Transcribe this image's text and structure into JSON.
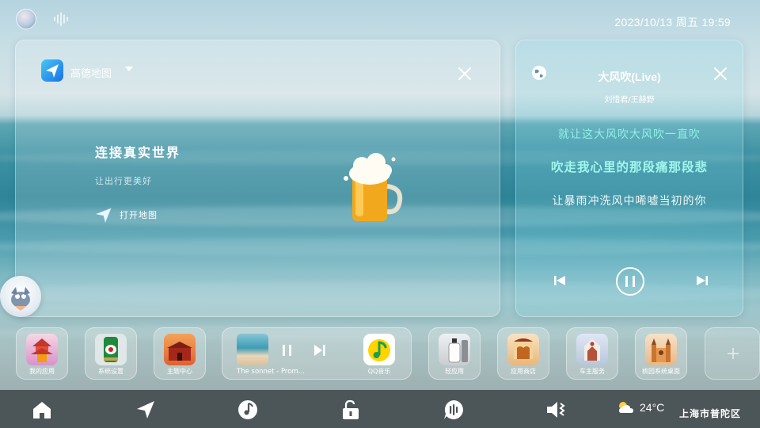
{
  "status_bar": {
    "datetime": "2023/10/13 周五 19:59"
  },
  "map_card": {
    "app_name": "高德地图",
    "slogan": "连接真实世界",
    "subtitle": "让出行更美好",
    "open_label": "打开地图"
  },
  "music_card": {
    "song_title": "大风吹(Live)",
    "artist": "刘惜君/王赫野",
    "lyrics": [
      "就让这大风吹大风吹一直吹",
      "吹走我心里的那段痛那段悲",
      "让暴雨冲洗风中唏嘘当初的你"
    ]
  },
  "dock": {
    "items": [
      {
        "label": "我的应用",
        "icon": "pavilion-app-icon"
      },
      {
        "label": "系统设置",
        "icon": "beer-can-icon"
      },
      {
        "label": "主题中心",
        "icon": "palace-icon"
      },
      {
        "label": "轻应用",
        "icon": "bottle-icon"
      },
      {
        "label": "应用商店",
        "icon": "temple-icon"
      },
      {
        "label": "车主服务",
        "icon": "church-icon"
      },
      {
        "label": "桃园系统桌面",
        "icon": "cathedral-icon"
      }
    ],
    "music_widget": {
      "track": "The sonnet - Prom...",
      "app_label": "QQ音乐"
    }
  },
  "bottom_bar": {
    "temperature": "24°C",
    "location": "上海市普陀区",
    "buttons": [
      "home-icon",
      "navigation-icon",
      "music-icon",
      "unlock-icon",
      "voice-assistant-icon",
      "volume-icon"
    ]
  },
  "colors": {
    "lyric_highlight": "#a2f7ea",
    "lyric_secondary": "#8ff0e6",
    "bottom_bar": "#4c5557"
  }
}
